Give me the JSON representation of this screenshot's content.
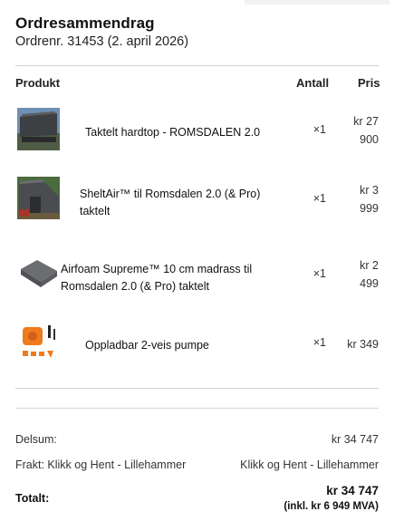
{
  "title": "Ordresammendrag",
  "order_info": "Ordrenr. 31453 (2. april 2026)",
  "columns": {
    "product": "Produkt",
    "quantity": "Antall",
    "price": "Pris"
  },
  "items": [
    {
      "name_line1": "Taktelt hardtop - ROMSDALEN 2.0",
      "name_line2": "",
      "quantity": "×1",
      "price_line1": "kr 27",
      "price_line2": "900",
      "image_icon": "roof-tent-icon"
    },
    {
      "name_line1": "SheltAir™ til Romsdalen 2.0 (& Pro)",
      "name_line2": "taktelt",
      "quantity": "×1",
      "price_line1": "kr 3",
      "price_line2": "999",
      "image_icon": "awning-tent-icon"
    },
    {
      "name_line1": "Airfoam Supreme™ 10 cm madrass til",
      "name_line2": "Romsdalen 2.0 (& Pro) taktelt",
      "quantity": "×1",
      "price_line1": "kr 2",
      "price_line2": "499",
      "image_icon": "mattress-icon"
    },
    {
      "name_line1": "Oppladbar 2-veis pumpe",
      "name_line2": "",
      "quantity": "×1",
      "price_line1": "kr 349",
      "price_line2": "",
      "image_icon": "pump-icon"
    }
  ],
  "summary": {
    "subtotal_label": "Delsum:",
    "subtotal_value": "kr 34 747",
    "shipping_label": "Frakt: Klikk og Hent - Lillehammer",
    "shipping_value": "Klikk og Hent - Lillehammer",
    "total_label": "Totalt:",
    "total_value": "kr 34 747",
    "total_vat": "(inkl. kr 6 949 MVA)"
  },
  "colors": {
    "divider": "#d3d3d3",
    "pump_orange": "#f07a1e"
  }
}
